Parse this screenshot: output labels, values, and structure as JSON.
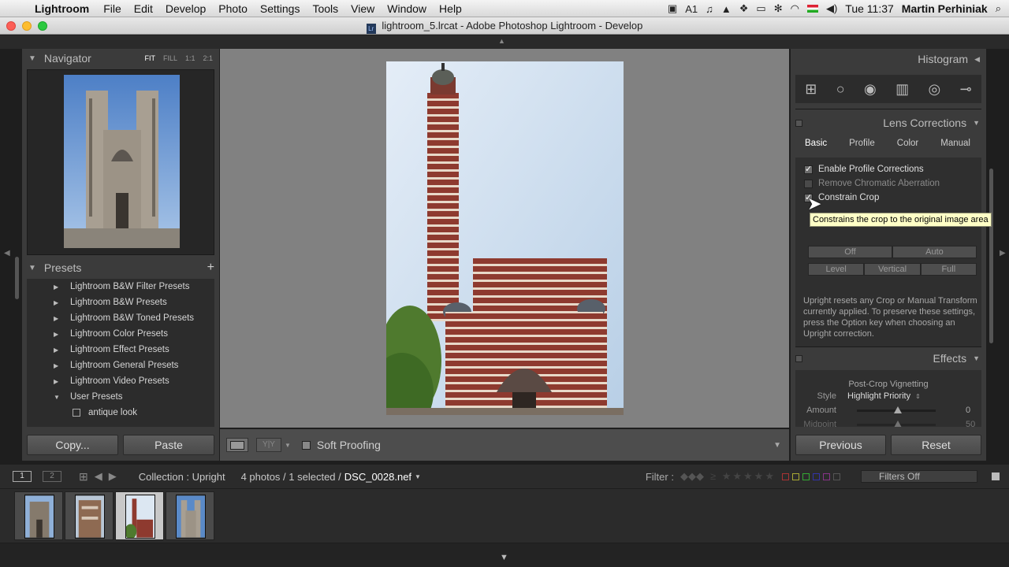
{
  "menubar": {
    "app_name": "Lightroom",
    "items": [
      "File",
      "Edit",
      "Develop",
      "Photo",
      "Settings",
      "Tools",
      "View",
      "Window",
      "Help"
    ],
    "adobe_count": "1",
    "clock": "Tue 11:37",
    "user": "Martin Perhiniak"
  },
  "window": {
    "title": "lightroom_5.lrcat - Adobe Photoshop Lightroom - Develop",
    "doc_icon": "Lr"
  },
  "navigator": {
    "title": "Navigator",
    "modes": [
      "FIT",
      "FILL",
      "1:1",
      "2:1"
    ]
  },
  "presets": {
    "title": "Presets",
    "items": [
      "Lightroom B&W Filter Presets",
      "Lightroom B&W Presets",
      "Lightroom B&W Toned Presets",
      "Lightroom Color Presets",
      "Lightroom Effect Presets",
      "Lightroom General Presets",
      "Lightroom Video Presets",
      "User Presets"
    ],
    "child": "antique look"
  },
  "left_buttons": {
    "copy": "Copy...",
    "paste": "Paste"
  },
  "toolbar": {
    "soft_proofing": "Soft Proofing",
    "yy": "Y|Y"
  },
  "right_panel": {
    "histogram": "Histogram",
    "lens_corrections": "Lens Corrections",
    "tabs": [
      "Basic",
      "Profile",
      "Color",
      "Manual"
    ],
    "checks": [
      {
        "label": "Enable Profile Corrections",
        "checked": true,
        "disabled": false
      },
      {
        "label": "Remove Chromatic Aberration",
        "checked": false,
        "disabled": true
      },
      {
        "label": "Constrain Crop",
        "checked": true,
        "disabled": false
      }
    ],
    "tooltip": "Constrains the crop to the original image area",
    "upright_row1": [
      "Off",
      "Auto"
    ],
    "upright_row2": [
      "Level",
      "Vertical",
      "Full"
    ],
    "upright_text": "Upright resets any Crop or Manual Transform currently applied. To preserve these settings, press the Option key when choosing an Upright correction.",
    "effects": "Effects",
    "vignette_title": "Post-Crop Vignetting",
    "style_label": "Style",
    "style_value": "Highlight Priority",
    "amount_label": "Amount",
    "amount_value": "0",
    "midpoint_label": "Midpoint",
    "midpoint_value": "50"
  },
  "right_buttons": {
    "previous": "Previous",
    "reset": "Reset"
  },
  "filmbar": {
    "monitor1": "1",
    "monitor2": "2",
    "collection": "Collection : Upright",
    "count": "4 photos / 1 selected /",
    "filename": "DSC_0028.nef",
    "filter_label": "Filter :",
    "filter_value": "Filters Off"
  },
  "colors": {
    "panel_bg": "#3b3b3b",
    "center_bg": "#818181",
    "tooltip_bg": "#ffffc6"
  }
}
